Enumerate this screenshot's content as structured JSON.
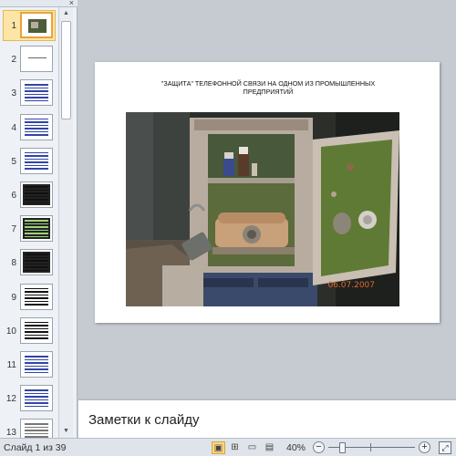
{
  "thumbnails": {
    "tab_close_glyph": "×",
    "items": [
      {
        "number": "1",
        "selected": true,
        "kind": "photo"
      },
      {
        "number": "2",
        "selected": false,
        "kind": "title"
      },
      {
        "number": "3",
        "selected": false,
        "kind": "text-blue"
      },
      {
        "number": "4",
        "selected": false,
        "kind": "text-blue"
      },
      {
        "number": "5",
        "selected": false,
        "kind": "text-blue"
      },
      {
        "number": "6",
        "selected": false,
        "kind": "table-dark"
      },
      {
        "number": "7",
        "selected": false,
        "kind": "table-green"
      },
      {
        "number": "8",
        "selected": false,
        "kind": "table-dark"
      },
      {
        "number": "9",
        "selected": false,
        "kind": "text-dark"
      },
      {
        "number": "10",
        "selected": false,
        "kind": "text-dark"
      },
      {
        "number": "11",
        "selected": false,
        "kind": "text-blue"
      },
      {
        "number": "12",
        "selected": false,
        "kind": "text-blue"
      },
      {
        "number": "13",
        "selected": false,
        "kind": "text-gray"
      }
    ],
    "scroll_up_glyph": "▲",
    "scroll_down_glyph": "▼"
  },
  "slide": {
    "title_line1": "\"ЗАЩИТА\" ТЕЛЕФОННОЙ СВЯЗИ НА ОДНОМ ИЗ ПРОМЫШЛЕННЫХ",
    "title_line2": "ПРЕДПРИЯТИЙ",
    "photo_date_stamp": "06.07.2007"
  },
  "notes": {
    "placeholder": "Заметки к слайду"
  },
  "statusbar": {
    "slide_counter": "Слайд 1 из 39",
    "zoom_label": "40%",
    "zoom_level_percent": 40,
    "zoom_out_glyph": "−",
    "zoom_in_glyph": "+",
    "view_buttons": [
      {
        "name": "normal-view",
        "glyph": "▣",
        "active": true
      },
      {
        "name": "slide-sorter-view",
        "glyph": "⊞",
        "active": false
      },
      {
        "name": "reading-view",
        "glyph": "▭",
        "active": false
      },
      {
        "name": "slideshow-view",
        "glyph": "▤",
        "active": false
      }
    ]
  },
  "colors": {
    "selection_fill": "#fce5a6",
    "selection_border": "#e8a23b",
    "stamp_orange": "#e06a2a"
  }
}
